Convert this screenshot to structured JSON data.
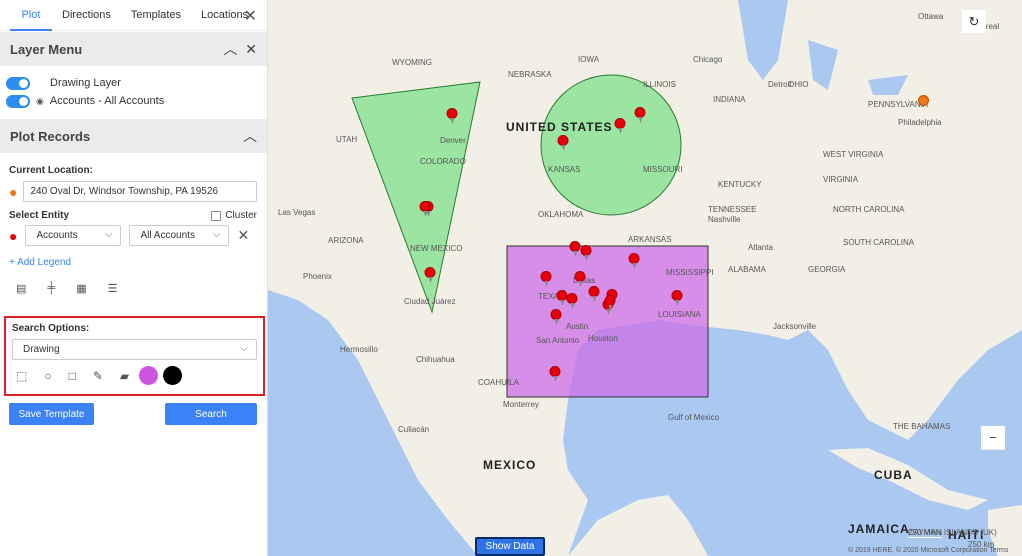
{
  "tabs": [
    "Plot",
    "Directions",
    "Templates",
    "Locations"
  ],
  "layer_menu": {
    "title": "Layer Menu",
    "layers": [
      {
        "label": "Drawing Layer",
        "on": true
      },
      {
        "label": "Accounts - All Accounts",
        "on": true
      }
    ]
  },
  "plot_records": {
    "title": "Plot Records",
    "current_location_label": "Current Location:",
    "current_location": "240 Oval Dr, Windsor Township, PA 19526",
    "select_entity_label": "Select Entity",
    "cluster_label": "Cluster",
    "entity": "Accounts",
    "view": "All Accounts",
    "add_legend": "+ Add Legend"
  },
  "search_options": {
    "label": "Search Options:",
    "mode": "Drawing",
    "fill_color": "#cc55e0",
    "stroke_color": "#000000"
  },
  "buttons": {
    "save_template": "Save Template",
    "search": "Search",
    "show_data": "Show Data"
  },
  "map": {
    "labels_big": [
      "UNITED STATES",
      "MEXICO",
      "CUBA",
      "JAMAICA",
      "HAITI"
    ],
    "labels": [
      "Denver",
      "COLORADO",
      "UTAH",
      "WYOMING",
      "NEBRASKA",
      "IOWA",
      "KANSAS",
      "MISSOURI",
      "OKLAHOMA",
      "ARKANSAS",
      "NEW MEXICO",
      "ARIZONA",
      "Las Vegas",
      "Phoenix",
      "TEXAS",
      "Dallas",
      "Austin",
      "San Antonio",
      "Houston",
      "LOUISIANA",
      "MISSISSIPPI",
      "ALABAMA",
      "GEORGIA",
      "TENNESSEE",
      "KENTUCKY",
      "ILLINOIS",
      "INDIANA",
      "OHIO",
      "Chicago",
      "Detroit",
      "WEST VIRGINIA",
      "VIRGINIA",
      "NORTH CAROLINA",
      "SOUTH CAROLINA",
      "PENNSYLVANIA",
      "Philadelphia",
      "Jacksonville",
      "Atlanta",
      "Nashville",
      "Hermosillo",
      "Chihuahua",
      "Ciudad Juárez",
      "Monterrey",
      "COAHUILA",
      "Culiacán",
      "Gulf of Mexico",
      "THE BAHAMAS",
      "CAYMAN ISLANDS (UK)",
      "Ottawa",
      "Montreal"
    ],
    "scale_miles": "250 Miles",
    "scale_km": "250 km",
    "copyright": "© 2019 HERE, © 2020 Microsoft Corporation  Terms",
    "triangle_color": "#7ee08a",
    "circle_color": "#7ee08a",
    "rect_color": "#cc6ee8"
  }
}
